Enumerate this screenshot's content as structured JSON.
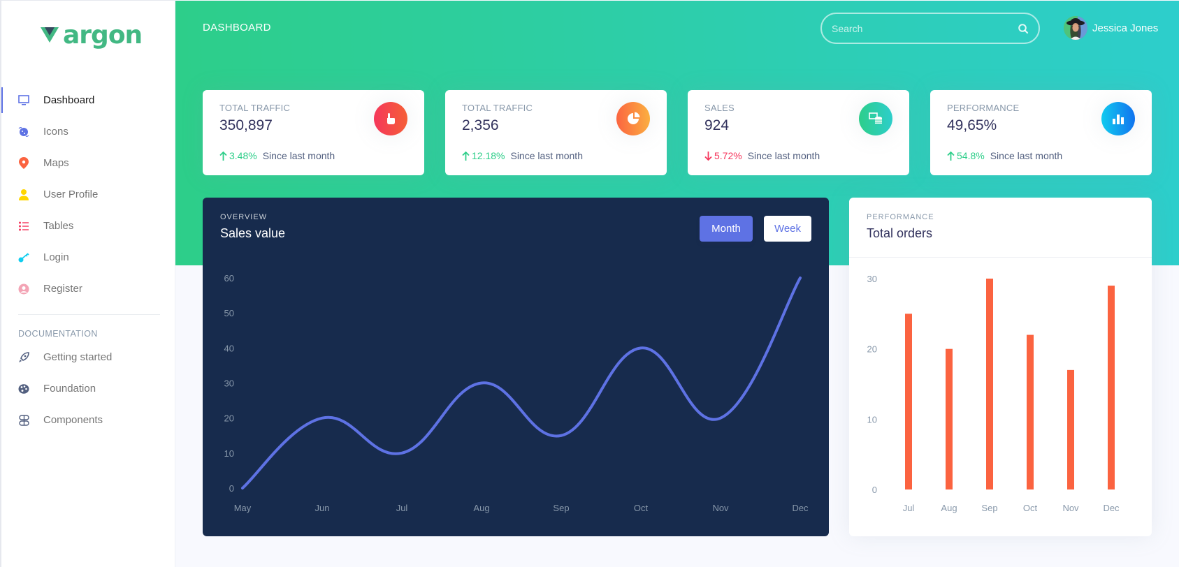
{
  "brand": {
    "name": "argon",
    "color": "#42b883"
  },
  "sidebar": {
    "items": [
      {
        "label": "Dashboard",
        "icon": "tv-icon",
        "color": "#5e72e4",
        "active": true
      },
      {
        "label": "Icons",
        "icon": "planet-icon",
        "color": "#5e72e4",
        "active": false
      },
      {
        "label": "Maps",
        "icon": "map-pin-icon",
        "color": "#fb6340",
        "active": false
      },
      {
        "label": "User Profile",
        "icon": "user-icon",
        "color": "#ffd600",
        "active": false
      },
      {
        "label": "Tables",
        "icon": "bullet-list-icon",
        "color": "#f5365c",
        "active": false
      },
      {
        "label": "Login",
        "icon": "key-icon",
        "color": "#11cdef",
        "active": false
      },
      {
        "label": "Register",
        "icon": "circle-user-icon",
        "color": "#f3a4b5",
        "active": false
      }
    ],
    "doc_heading": "DOCUMENTATION",
    "doc_items": [
      {
        "label": "Getting started",
        "icon": "rocket-icon"
      },
      {
        "label": "Foundation",
        "icon": "palette-icon"
      },
      {
        "label": "Components",
        "icon": "ui-components-icon"
      }
    ]
  },
  "header": {
    "title": "DASHBOARD",
    "search_placeholder": "Search",
    "user_name": "Jessica Jones"
  },
  "stats": [
    {
      "title": "TOTAL TRAFFIC",
      "value": "350,897",
      "change": "3.48%",
      "direction": "up",
      "since": "Since last month",
      "icon": "hand-pointer-icon",
      "gradient": [
        "#f5365c",
        "#f56036"
      ]
    },
    {
      "title": "TOTAL TRAFFIC",
      "value": "2,356",
      "change": "12.18%",
      "direction": "up",
      "since": "Since last month",
      "icon": "pie-chart-icon",
      "gradient": [
        "#fb6340",
        "#fbb140"
      ]
    },
    {
      "title": "SALES",
      "value": "924",
      "change": "5.72%",
      "direction": "down",
      "since": "Since last month",
      "icon": "money-coins-icon",
      "gradient": [
        "#2dce89",
        "#2dcecc"
      ]
    },
    {
      "title": "PERFORMANCE",
      "value": "49,65%",
      "change": "54.8%",
      "direction": "up",
      "since": "Since last month",
      "icon": "bar-chart-icon",
      "gradient": [
        "#11cdef",
        "#1171ef"
      ]
    }
  ],
  "sales_card": {
    "eyebrow": "OVERVIEW",
    "title": "Sales value",
    "buttons": {
      "month": "Month",
      "week": "Week"
    },
    "active_range": "Month"
  },
  "orders_card": {
    "eyebrow": "PERFORMANCE",
    "title": "Total orders"
  },
  "chart_data": [
    {
      "type": "line",
      "title": "Sales value",
      "categories": [
        "May",
        "Jun",
        "Jul",
        "Aug",
        "Sep",
        "Oct",
        "Nov",
        "Dec"
      ],
      "values": [
        0,
        20,
        10,
        30,
        15,
        40,
        20,
        60
      ],
      "ylim": [
        0,
        60
      ],
      "yticks": [
        0,
        10,
        20,
        30,
        40,
        50,
        60
      ],
      "grid": false,
      "color": "#5e72e4"
    },
    {
      "type": "bar",
      "title": "Total orders",
      "categories": [
        "Jul",
        "Aug",
        "Sep",
        "Oct",
        "Nov",
        "Dec"
      ],
      "values": [
        25,
        20,
        30,
        22,
        17,
        29
      ],
      "ylim": [
        0,
        30
      ],
      "yticks": [
        0,
        10,
        20,
        30
      ],
      "grid": false,
      "color": "#fb6340"
    }
  ]
}
